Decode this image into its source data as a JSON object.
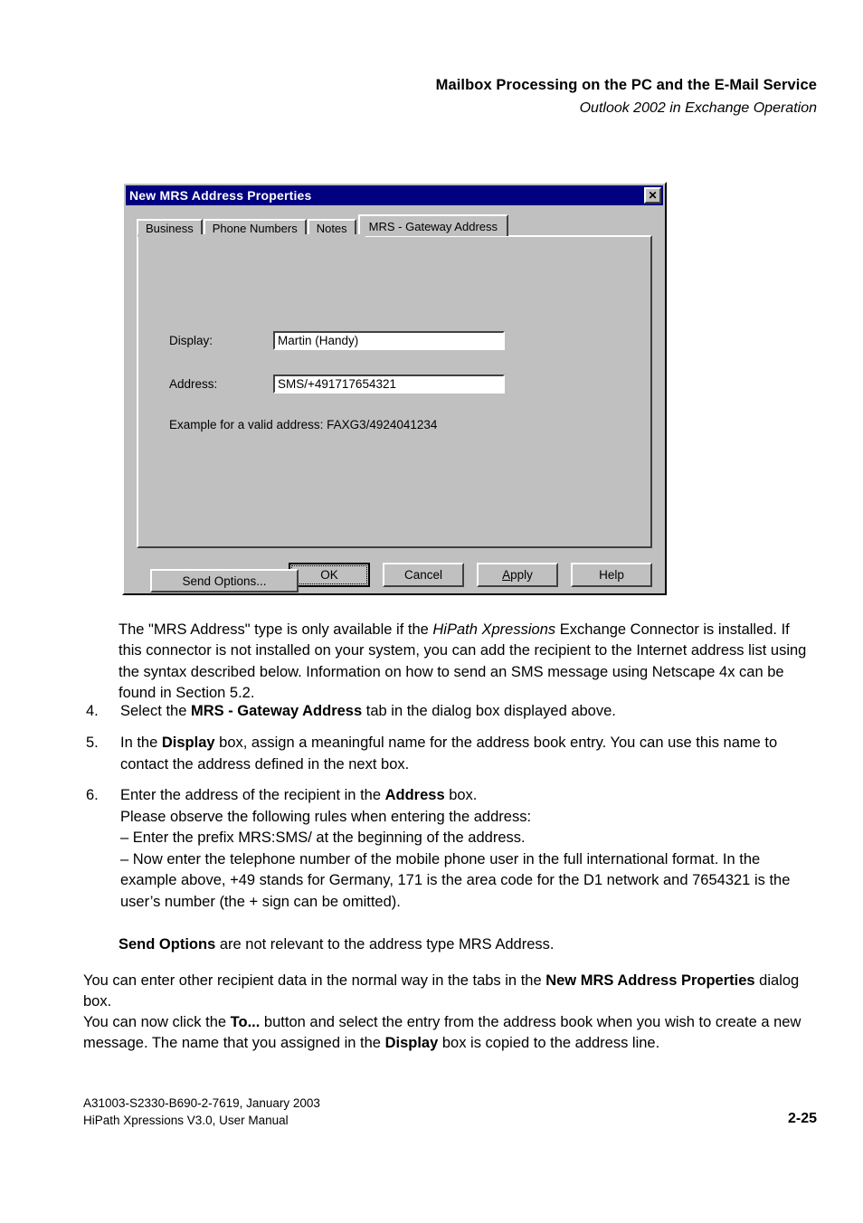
{
  "header": {
    "title": "Mailbox Processing on the PC and the E-Mail Service",
    "subtitle": "Outlook 2002 in Exchange Operation"
  },
  "dialog": {
    "title": "New MRS Address Properties",
    "close_icon_label": "✕",
    "titlebar_color": "#000080",
    "face_color": "#c0c0c0",
    "tabs": [
      {
        "label": "Business",
        "active": false
      },
      {
        "label": "Phone Numbers",
        "active": false
      },
      {
        "label": "Notes",
        "active": false
      },
      {
        "label": "MRS - Gateway Address",
        "active": true
      }
    ],
    "fields": {
      "display_label": "Display:",
      "display_value": "Martin (Handy)",
      "address_label": "Address:",
      "address_value": "SMS/+491717654321"
    },
    "example_text": "Example for a valid address: FAXG3/4924041234",
    "send_options_label": "Send Options...",
    "buttons": {
      "ok": "OK",
      "cancel": "Cancel",
      "apply_pre": "A",
      "apply_post": "pply",
      "help": "Help"
    }
  },
  "body": {
    "intro": {
      "t1": "The \"MRS Address\" type is only available if the ",
      "em1": "HiPath Xpressions",
      "t2": " Exchange Connector is installed. If this connector is not installed on your system, you can add the recipient to the Internet address list using the syntax described below. Information on how to send an SMS message using Netscape 4x can be found in Section 5.2."
    },
    "item4": {
      "num": "4.",
      "t1": "Select the ",
      "b1": "MRS - Gateway Address",
      "t2": " tab in the dialog box displayed above."
    },
    "item5": {
      "num": "5.",
      "t1": "In the ",
      "b1": "Display",
      "t2": " box, assign a meaningful name for the address book entry. You can use this name to contact the address defined in the next box."
    },
    "item6": {
      "num": "6.",
      "t1": "Enter the address of the recipient in the ",
      "b1": "Address",
      "t2": " box.",
      "line2": "Please observe the following rules when entering the address:",
      "line3_pre": "– Enter the prefix ",
      "line3_mono": "MRS:SMS/",
      "line3_post": " at the beginning of the address.",
      "line4_pre": "– Now enter the telephone number of the mobile phone user in the full international format. In the example above, ",
      "line4_mono1": "+49",
      "line4_mid1": " stands for Germany, ",
      "line4_mono2": "171",
      "line4_mid2": " is the area code for the D1 network and ",
      "line4_mono3": "7654321",
      "line4_mid3": " is the user’s number (the ",
      "line4_mono4": "+",
      "line4_post": " sign can be omitted)."
    },
    "send_options_note": {
      "b1": "Send Options",
      "t1": " are not relevant to the address type MRS Address."
    },
    "closing1": {
      "t1": "You can enter other recipient data in the normal way in the tabs in the ",
      "b1": "New MRS Address Properties",
      "t2": " dialog box."
    },
    "closing2": {
      "t1": "You can now click the ",
      "b1": "To...",
      "t2": " button and select the entry from the address book when you wish to create a new message. The name that you assigned in the ",
      "b2": "Display",
      "t3": " box is copied to the address line."
    }
  },
  "footer": {
    "line1": "A31003-S2330-B690-2-7619, January 2003",
    "line2": "HiPath Xpressions V3.0, User Manual",
    "page": "2-25"
  }
}
